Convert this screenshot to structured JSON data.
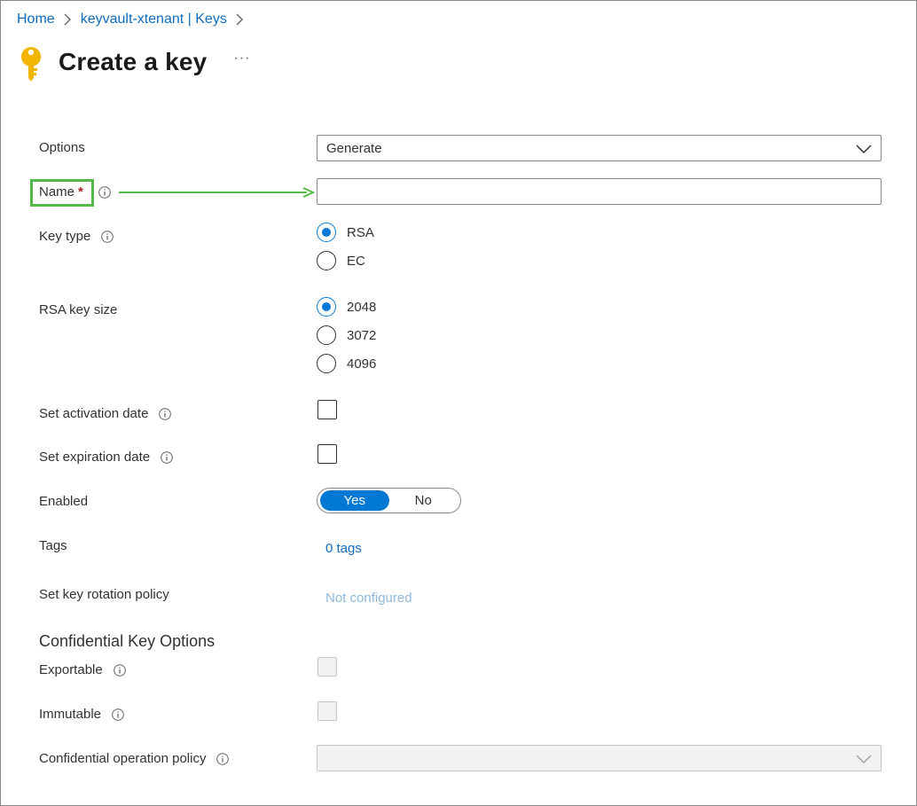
{
  "breadcrumb": {
    "items": [
      "Home",
      "keyvault-xtenant | Keys"
    ]
  },
  "page": {
    "title": "Create a key",
    "more": "···"
  },
  "form": {
    "options": {
      "label": "Options",
      "value": "Generate"
    },
    "name": {
      "label": "Name",
      "required_mark": "*",
      "value": ""
    },
    "key_type": {
      "label": "Key type",
      "options": [
        "RSA",
        "EC"
      ],
      "selected": "RSA"
    },
    "rsa_key_size": {
      "label": "RSA key size",
      "options": [
        "2048",
        "3072",
        "4096"
      ],
      "selected": "2048"
    },
    "activation": {
      "label": "Set activation date",
      "checked": false
    },
    "expiration": {
      "label": "Set expiration date",
      "checked": false
    },
    "enabled": {
      "label": "Enabled",
      "yes": "Yes",
      "no": "No",
      "selected": "Yes"
    },
    "tags": {
      "label": "Tags",
      "value": "0 tags"
    },
    "rotation": {
      "label": "Set key rotation policy",
      "value": "Not configured"
    }
  },
  "confidential": {
    "section_title": "Confidential Key Options",
    "exportable": {
      "label": "Exportable",
      "checked": false,
      "disabled": true
    },
    "immutable": {
      "label": "Immutable",
      "checked": false,
      "disabled": true
    },
    "policy": {
      "label": "Confidential operation policy",
      "value": "",
      "disabled": true
    }
  },
  "colors": {
    "accent": "#0078d4",
    "link": "#0f6cbd",
    "highlight": "#54b948",
    "required": "#a4262c"
  }
}
